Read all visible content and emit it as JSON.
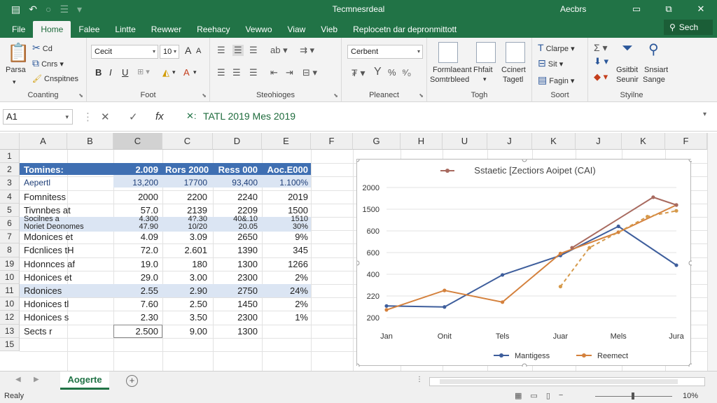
{
  "titlebar": {
    "title": "Tecmnesrdeal",
    "user": "Aecbrs",
    "minimize": "▭",
    "restore": "⧉",
    "close": "✕"
  },
  "tabs": [
    "File",
    "Home",
    "Falee",
    "Lintte",
    "Rewwer",
    "Reehacy",
    "Vewwo",
    "Viaw",
    "Vieb",
    "Replocetn dar depronmittott"
  ],
  "search_label": "Sech",
  "ribbon": {
    "clipboard": {
      "paste": "Parsa",
      "cut": "Cd",
      "copy": "Cnrs",
      "format": "Cnspitnes",
      "label": "Coanting"
    },
    "font": {
      "name": "Cecit",
      "size": "10",
      "bold": "B",
      "italic": "I",
      "underline": "U",
      "label": "Foot"
    },
    "alignment": {
      "label": "Steohioges"
    },
    "number": {
      "format": "Cerbent",
      "label": "Pleanect"
    },
    "styles": {
      "conditional": "Formlaeant",
      "conditional2": "Somtrbleed",
      "format_table": "Fhfait",
      "cell_styles": "Ccinert",
      "cell_styles2": "Tagetl",
      "label": "Togh"
    },
    "cells": {
      "insert": "Clarpe",
      "delete": "Sit",
      "format": "Fagin",
      "label": "Soort"
    },
    "editing": {
      "sort": "Gsitbit",
      "sort2": "Seunir",
      "find": "Snsiart",
      "find2": "Sange",
      "label": "Styilne"
    }
  },
  "formula_bar": {
    "name_box": "A1",
    "cancel": "✕",
    "enter": "✓",
    "fx": "fx",
    "value": "TATL 2019   Mes 2019",
    "prefix": "✕:"
  },
  "columns": [
    "A",
    "B",
    "C",
    "C",
    "D",
    "E",
    "F",
    "G",
    "H",
    "U",
    "J",
    "K",
    "J",
    "K",
    "F"
  ],
  "rows": [
    "1",
    "2",
    "3",
    "4",
    "5",
    "6",
    "7",
    "8",
    "19",
    "10",
    "11",
    "10",
    "12",
    "13",
    "15"
  ],
  "table": {
    "header": [
      "Tomines:",
      "2.009",
      "Rors 2000",
      "Ress 000",
      "Aoc.E000"
    ],
    "subheader": [
      "Aepertl",
      "13,200",
      "17700",
      "93,400",
      "1.100%"
    ],
    "body": [
      [
        "Fomnitess",
        "2000",
        "2200",
        "2240",
        "2019"
      ],
      [
        "Tivnnbes at",
        "57.0",
        "2139",
        "2209",
        "1500"
      ],
      [
        "Socilnes a\nNoriet Deonomes",
        "4.300\n47.90",
        "4?.30\n10/20",
        "40&.10\n20.05",
        "1510\n30%"
      ],
      [
        "Mdonices et",
        "4.09",
        "3.09",
        "2650",
        "9%"
      ],
      [
        "Fdcnlices tH",
        "72.0",
        "2.601",
        "1390",
        "345"
      ],
      [
        "Hdonnces af",
        "19.0",
        "180",
        "1300",
        "1266"
      ],
      [
        "Hdonices et",
        "29.0",
        "3.00",
        "2300",
        "2%"
      ],
      [
        "Rdonices",
        "2.55",
        "2.90",
        "2750",
        "24%"
      ],
      [
        "Hdonices tl",
        "7.60",
        "2.50",
        "1450",
        "2%"
      ],
      [
        "Hdonices s",
        "2.30",
        "3.50",
        "2300",
        "1%"
      ],
      [
        "Sects r",
        "2.500",
        "9.00",
        "1300",
        ""
      ]
    ]
  },
  "chart_data": {
    "type": "line",
    "title": "Sstaetic [Zectiors Aoipet (CAI)",
    "categories": [
      "Jan",
      "Onit",
      "Tels",
      "Juar",
      "Mels",
      "Jura"
    ],
    "y_tick_labels": [
      "200",
      "220",
      "400",
      "600",
      "600",
      "1500",
      "2000"
    ],
    "legend_position": "bottom",
    "series": [
      {
        "name": "Mantigess",
        "color": "#3e5e9c",
        "points": [
          [
            0,
            240
          ],
          [
            1,
            235
          ],
          [
            2,
            400
          ],
          [
            3,
            500
          ],
          [
            4,
            650
          ],
          [
            5,
            450
          ]
        ]
      },
      {
        "name": "Reemect",
        "color": "#d4813d",
        "points": [
          [
            0,
            220
          ],
          [
            1,
            320
          ],
          [
            2,
            260
          ],
          [
            3,
            510
          ],
          [
            4,
            620
          ],
          [
            5,
            760
          ]
        ]
      },
      {
        "name": "",
        "color": "#d69a4b",
        "dashed": true,
        "points": [
          [
            3,
            340
          ],
          [
            3.5,
            540
          ],
          [
            4.5,
            700
          ],
          [
            5,
            730
          ]
        ]
      },
      {
        "name": "",
        "color": "#a86a5f",
        "points": [
          [
            3.2,
            540
          ],
          [
            4.6,
            800
          ],
          [
            5,
            760
          ]
        ]
      }
    ]
  },
  "sheet_tab": "Aogerte",
  "status": {
    "ready": "Realy",
    "zoom": "10%"
  }
}
